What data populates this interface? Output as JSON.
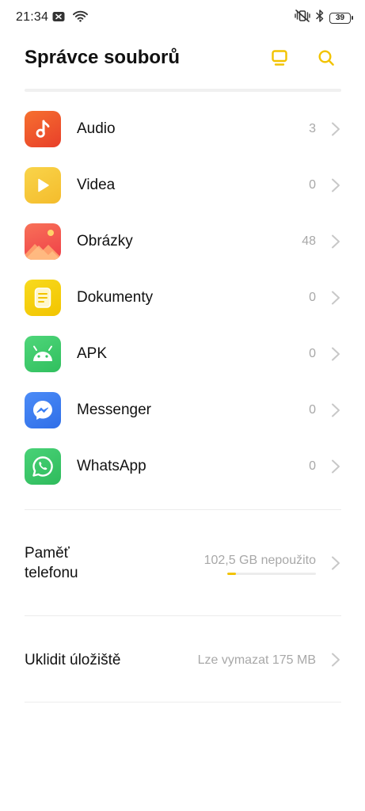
{
  "status_bar": {
    "time": "21:34",
    "battery": "39",
    "icons": [
      "notification-x-icon",
      "wifi-icon",
      "vibrate-icon",
      "bluetooth-icon",
      "battery-icon"
    ]
  },
  "header": {
    "title": "Správce souborů",
    "actions": [
      "desktop-icon",
      "search-icon"
    ],
    "accent_color": "#f2c300"
  },
  "categories": [
    {
      "label": "Audio",
      "count": "3",
      "icon": "music-note-icon",
      "color": "#f0552d"
    },
    {
      "label": "Videa",
      "count": "0",
      "icon": "play-icon",
      "color": "#f7c93a"
    },
    {
      "label": "Obrázky",
      "count": "48",
      "icon": "image-icon",
      "color": "#f4594a"
    },
    {
      "label": "Dokumenty",
      "count": "0",
      "icon": "document-icon",
      "color": "#f5d000"
    },
    {
      "label": "APK",
      "count": "0",
      "icon": "android-icon",
      "color": "#3ecb6a"
    },
    {
      "label": "Messenger",
      "count": "0",
      "icon": "messenger-icon",
      "color": "#3a7ef4"
    },
    {
      "label": "WhatsApp",
      "count": "0",
      "icon": "whatsapp-icon",
      "color": "#37c466"
    }
  ],
  "storage": {
    "label": "Paměť\ntelefonu",
    "free": "102,5 GB nepoužito",
    "used_fraction": 0.1
  },
  "cleanup": {
    "label": "Uklidit úložiště",
    "value": "Lze vymazat 175 MB"
  }
}
